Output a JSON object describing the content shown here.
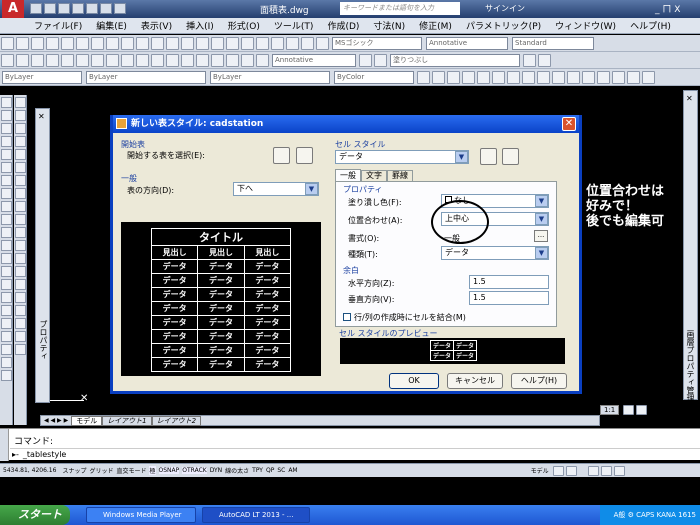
{
  "app": {
    "doc_title": "面積表.dwg",
    "search_placeholder": "キーワードまたは語句を入力",
    "signin": "サインイン",
    "win_buttons": "_ ㄇ X"
  },
  "menu": [
    "ファイル(F)",
    "編集(E)",
    "表示(V)",
    "挿入(I)",
    "形式(O)",
    "ツール(T)",
    "作成(D)",
    "寸法(N)",
    "修正(M)",
    "パラメトリック(P)",
    "ウィンドウ(W)",
    "ヘルプ(H)"
  ],
  "toolbars": {
    "textstyle": "MSゴシック",
    "annotative1": "Annotative",
    "standard": "Standard",
    "annotative2": "Annotative",
    "layer_combo": "塗りつぶし",
    "bylayer1": "ByLayer",
    "bylayer2": "ByLayer",
    "bylayer3": "ByLayer",
    "bycolor": "ByColor"
  },
  "dialog": {
    "title": "新しい表スタイル: cadstation",
    "start_table": {
      "header": "開始表",
      "label": "開始する表を選択(E):"
    },
    "general": {
      "header": "一般",
      "direction_label": "表の方向(D):",
      "direction_value": "下へ"
    },
    "preview_table": {
      "title": "タイトル",
      "headers": [
        "見出し",
        "見出し",
        "見出し"
      ],
      "rows": [
        [
          "データ",
          "データ",
          "データ"
        ],
        [
          "データ",
          "データ",
          "データ"
        ],
        [
          "データ",
          "データ",
          "データ"
        ],
        [
          "データ",
          "データ",
          "データ"
        ],
        [
          "データ",
          "データ",
          "データ"
        ],
        [
          "データ",
          "データ",
          "データ"
        ],
        [
          "データ",
          "データ",
          "データ"
        ],
        [
          "データ",
          "データ",
          "データ"
        ]
      ]
    },
    "cell_style": {
      "header": "セル スタイル",
      "value": "データ",
      "tabs": [
        "一般",
        "文字",
        "罫線"
      ],
      "properties": {
        "header": "プロパティ",
        "fill_label": "塗り潰し色(F):",
        "fill_value": "なし",
        "align_label": "位置合わせ(A):",
        "align_value": "上中心",
        "format_label": "書式(O):",
        "format_value": "一般",
        "type_label": "種類(T):",
        "type_value": "データ"
      },
      "margins": {
        "header": "余白",
        "horizontal_label": "水平方向(Z):",
        "horizontal_value": "1.5",
        "vertical_label": "垂直方向(V):",
        "vertical_value": "1.5"
      },
      "merge_label": "行/列の作成時にセルを結合(M)",
      "preview_header": "セル スタイルのプレビュー",
      "preview_cells": [
        "データ",
        "データ",
        "データ",
        "データ"
      ]
    },
    "buttons": {
      "ok": "OK",
      "cancel": "キャンセル",
      "help": "ヘルプ(H)"
    }
  },
  "annotation": [
    "位置合わせは",
    "好みで！",
    "後でも編集可"
  ],
  "side_labels": {
    "properties": "プロパティ",
    "right": "画層プロパティ管理"
  },
  "tabs": {
    "model": "モデル",
    "layout1": "レイアウト1",
    "layout2": "レイアウト2"
  },
  "command": {
    "prompt": "コマンド:",
    "input": "_tablestyle"
  },
  "status": {
    "coords": "5434.81, 4206.16",
    "toggles": [
      "スナップ",
      "グリッド",
      "直交モード",
      "極",
      "OSNAP",
      "OTRACK",
      "DYN",
      "線の太さ",
      "TPY",
      "QP",
      "SC",
      "AM"
    ],
    "model_label": "モデル",
    "scale": "1:1"
  },
  "taskbar": {
    "start": "スタート",
    "tasks": [
      "Windows Media Player",
      "AutoCAD LT 2013 - ..."
    ],
    "tray": "A般 ⚙ CAPS KANA  1615"
  }
}
